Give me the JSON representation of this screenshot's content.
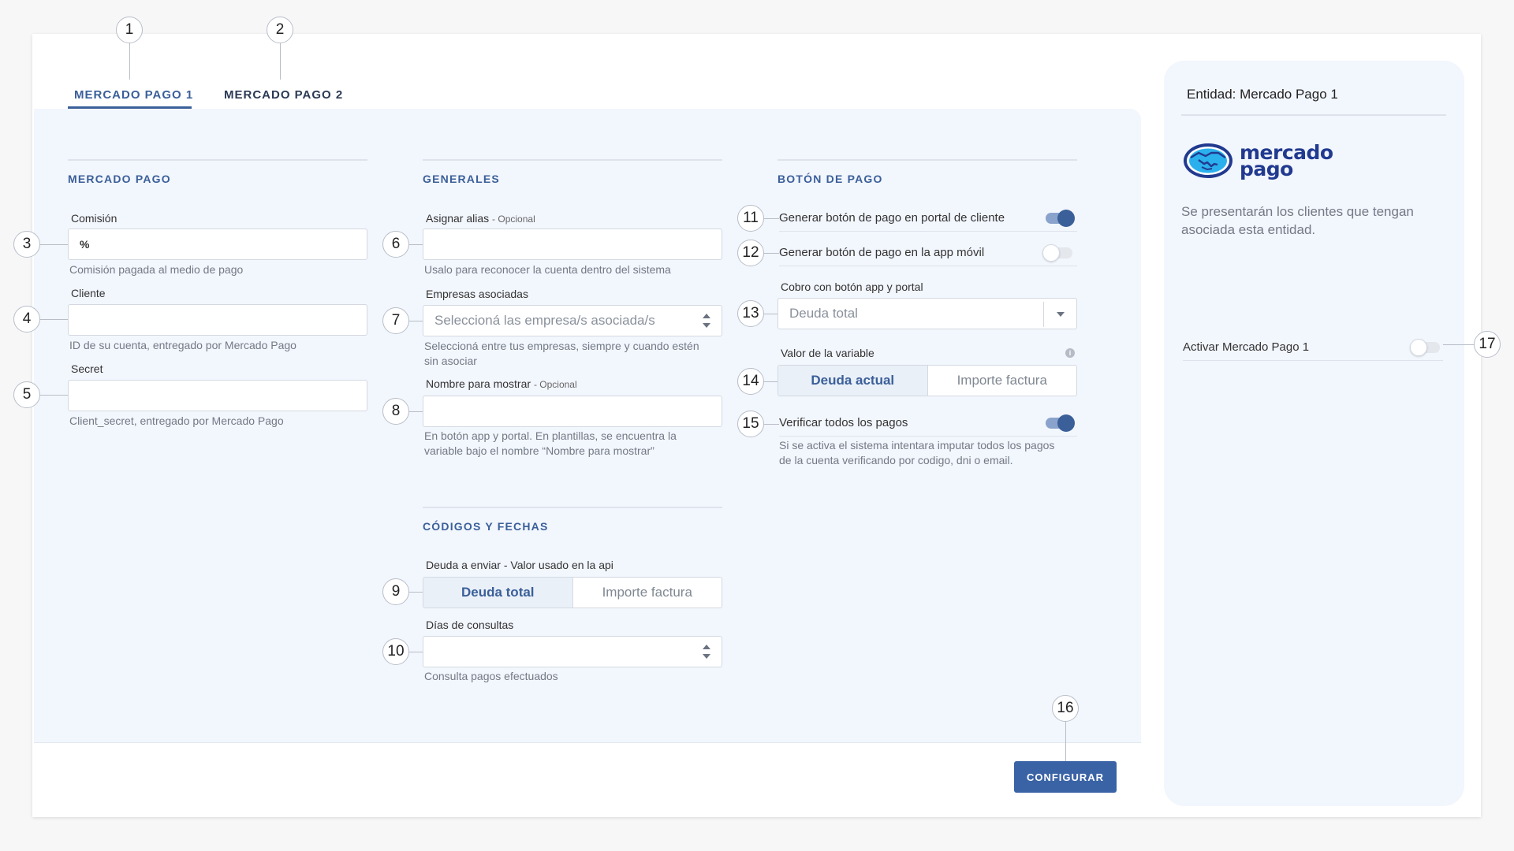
{
  "tabs": [
    "MERCADO PAGO 1",
    "MERCADO PAGO 2"
  ],
  "sections": {
    "mercado_pago": "MERCADO PAGO",
    "generales": "GENERALES",
    "boton_pago": "BOTÓN DE PAGO",
    "codigos": "CÓDIGOS Y FECHAS"
  },
  "mp": {
    "comision_label": "Comisión",
    "comision_suffix": "%",
    "comision_help": "Comisión pagada al medio de pago",
    "cliente_label": "Cliente",
    "cliente_help": "ID de su cuenta, entregado por Mercado Pago",
    "secret_label": "Secret",
    "secret_help": "Client_secret, entregado por Mercado Pago"
  },
  "generales": {
    "alias_label": "Asignar alias",
    "alias_optional": "- Opcional",
    "alias_help": "Usalo para reconocer la cuenta dentro del sistema",
    "empresas_label": "Empresas asociadas",
    "empresas_placeholder": "Seleccioná las empresa/s asociada/s",
    "empresas_help_1": "Seleccioná entre tus empresas, siempre y cuando estén",
    "empresas_help_2": "sin asociar",
    "nombre_label": "Nombre para mostrar",
    "nombre_optional": "- Opcional",
    "nombre_help_1": "En botón app y portal. En plantillas, se encuentra la",
    "nombre_help_2": "variable bajo el nombre “Nombre para mostrar”"
  },
  "codigos": {
    "deuda_label": "Deuda a enviar - Valor usado en la api",
    "deuda_options": [
      "Deuda total",
      "Importe factura"
    ],
    "dias_label": "Días de consultas",
    "dias_help": "Consulta pagos efectuados"
  },
  "boton": {
    "portal_label": "Generar botón de pago en portal de cliente",
    "portal_on": true,
    "app_label": "Generar botón de pago en la app móvil",
    "app_on": false,
    "cobro_label": "Cobro con botón app y portal",
    "cobro_value": "Deuda total",
    "variable_label": "Valor de la variable",
    "variable_options": [
      "Deuda actual",
      "Importe factura"
    ],
    "verificar_label": "Verificar todos los pagos",
    "verificar_on": true,
    "verificar_help_1": "Si se activa el sistema intentara imputar todos los pagos",
    "verificar_help_2": "de la cuenta verificando por codigo, dni o email."
  },
  "footer": {
    "configurar": "CONFIGURAR"
  },
  "side": {
    "title": "Entidad: Mercado Pago 1",
    "logo_line1": "mercado",
    "logo_line2": "pago",
    "description": "Se presentarán los clientes que tengan asociada esta entidad.",
    "activar_label": "Activar Mercado Pago 1",
    "activar_on": false
  },
  "callouts": [
    "1",
    "2",
    "3",
    "4",
    "5",
    "6",
    "7",
    "8",
    "9",
    "10",
    "11",
    "12",
    "13",
    "14",
    "15",
    "16",
    "17"
  ],
  "colors": {
    "accent": "#3a5f99",
    "button": "#3a63a6",
    "panel": "#f2f6fd",
    "brand_logo": "#213a8f"
  }
}
